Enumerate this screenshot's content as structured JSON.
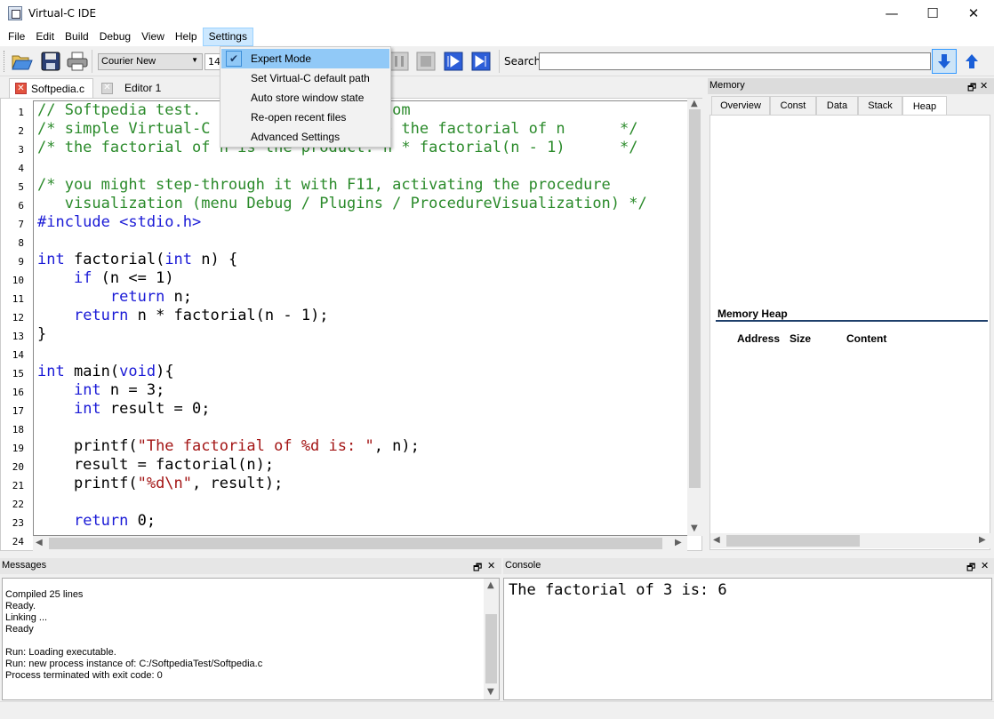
{
  "window": {
    "title": "Virtual-C IDE",
    "minimize": "—",
    "maximize": "☐",
    "close": "✕"
  },
  "menu": [
    "File",
    "Edit",
    "Build",
    "Debug",
    "View",
    "Help",
    "Settings"
  ],
  "toolbar": {
    "font_value": "Courier New",
    "size_value": "14",
    "search_label": "Search:",
    "search_value": ""
  },
  "settings_menu": [
    {
      "label": "Expert Mode",
      "checked": true
    },
    {
      "label": "Set Virtual-C default path",
      "checked": false
    },
    {
      "label": "Auto store window state",
      "checked": false
    },
    {
      "label": "Re-open recent files",
      "checked": false
    },
    {
      "label": "Advanced Settings",
      "checked": false
    }
  ],
  "editor": {
    "tabs": [
      {
        "label": "Softpedia.c",
        "active": true
      },
      {
        "label": "Editor 1",
        "active": false
      }
    ],
    "line_numbers": [
      "1",
      "2",
      "3",
      "4",
      "5",
      "6",
      "7",
      "8",
      "9",
      "10",
      "11",
      "12",
      "13",
      "14",
      "15",
      "16",
      "17",
      "18",
      "19",
      "20",
      "21",
      "22",
      "23",
      "24"
    ],
    "code": [
      "// Softpedia test.                 ia.com",
      "/* simple Virtual-C                late the factorial of n      */",
      "/* the factorial of n is the product: n * factorial(n - 1)      */",
      "",
      "/* you might step-through it with F11, activating the procedure",
      "   visualization (menu Debug / Plugins / ProcedureVisualization) */",
      "#include <stdio.h>",
      "",
      "int factorial(int n) {",
      "    if (n <= 1)",
      "        return n;",
      "    return n * factorial(n - 1);",
      "}",
      "",
      "int main(void){",
      "    int n = 3;",
      "    int result = 0;",
      "",
      "    printf(\"The factorial of %d is: \", n);",
      "    result = factorial(n);",
      "    printf(\"%d\\n\", result);",
      "",
      "    return 0;",
      ""
    ]
  },
  "memory": {
    "title": "Memory",
    "tabs": [
      "Overview",
      "Const",
      "Data",
      "Stack",
      "Heap"
    ],
    "active_tab": "Heap",
    "heap_title": "Memory Heap",
    "columns": [
      "Address",
      "Size",
      "Content"
    ]
  },
  "messages": {
    "title": "Messages",
    "lines": [
      "Compiled 25 lines",
      "Ready.",
      "Linking ...",
      "Ready",
      "",
      "Run: Loading executable.",
      "Run: new process instance of: C:/SoftpediaTest/Softpedia.c",
      "Process terminated with exit code: 0"
    ]
  },
  "console": {
    "title": "Console",
    "output": "The factorial of 3 is: 6"
  },
  "pane_controls": {
    "float": "🗗",
    "close": "✕"
  },
  "colors": {
    "comment": "#2a8a2a",
    "keyword": "#1a1ad6",
    "string": "#a31515",
    "menu_highlight": "#cce8ff",
    "nav_selected": "#cce4f7"
  }
}
